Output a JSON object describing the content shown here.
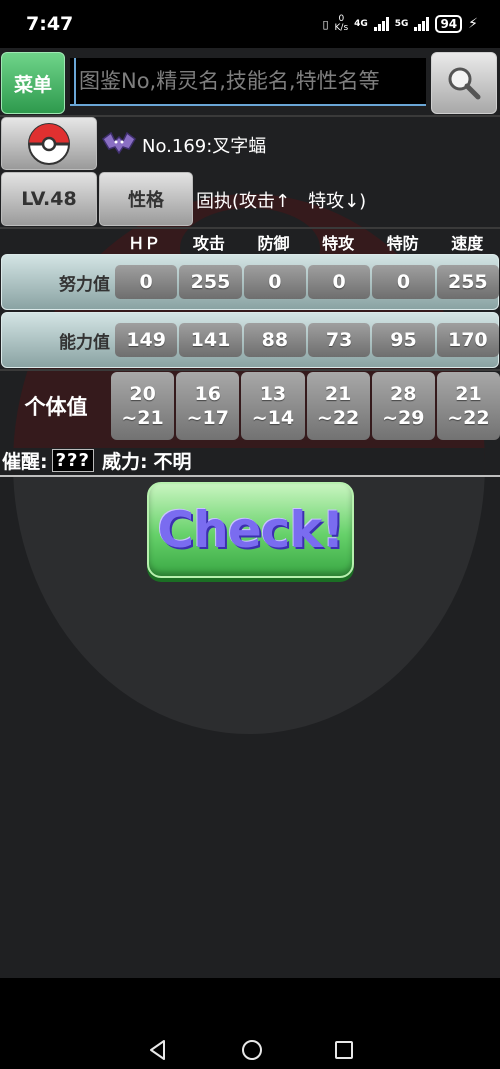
{
  "status_bar": {
    "time": "7:47",
    "net_speed_value": "0",
    "net_speed_unit": "K/s",
    "network_1": "4G",
    "network_2": "5G",
    "battery": "94"
  },
  "header": {
    "menu_label": "菜单",
    "search_placeholder": "图鉴No,精灵名,技能名,特性名等"
  },
  "pokemon": {
    "name": "No.169:叉字蝠",
    "level_label": "LV.48",
    "nature_button": "性格",
    "nature_text": "固执(攻击↑　特攻↓)"
  },
  "stats": {
    "headers": [
      "ＨＰ",
      "攻击",
      "防御",
      "特攻",
      "特防",
      "速度"
    ],
    "ev": {
      "label": "努力值",
      "values": [
        "0",
        "255",
        "0",
        "0",
        "0",
        "255"
      ]
    },
    "actual": {
      "label": "能力值",
      "values": [
        "149",
        "141",
        "88",
        "73",
        "95",
        "170"
      ]
    },
    "iv": {
      "label": "个体值",
      "values": [
        {
          "min": "20",
          "max": "~21"
        },
        {
          "min": "16",
          "max": "~17"
        },
        {
          "min": "13",
          "max": "~14"
        },
        {
          "min": "21",
          "max": "~22"
        },
        {
          "min": "28",
          "max": "~29"
        },
        {
          "min": "21",
          "max": "~22"
        }
      ]
    }
  },
  "hidden_power": {
    "label": "催醒:",
    "type": "???",
    "power_label": "威力:",
    "power_value": "不明"
  },
  "check_button": "Check!",
  "colors": {
    "menu_green": "#3fae5c",
    "check_green": "#66d16a",
    "check_text": "#7a6cf0",
    "row_teal": "#a9c2c2"
  }
}
